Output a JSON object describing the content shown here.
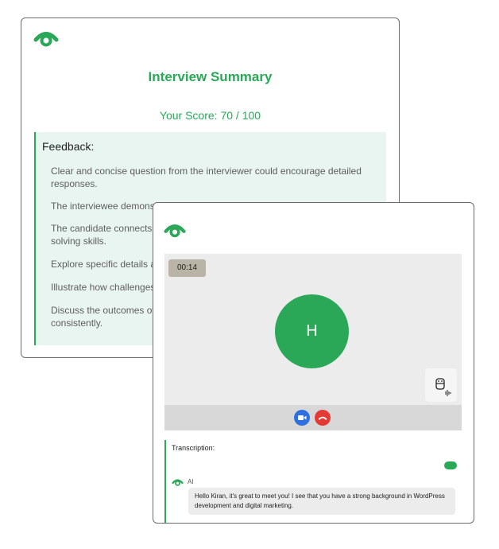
{
  "summary": {
    "logo_icon": "brand-logo-icon",
    "title": "Interview Summary",
    "score": "Your Score: 70 / 100",
    "feedback_title": "Feedback:",
    "feedback_items": [
      "Clear and concise question from the interviewer could encourage detailed responses.",
      "The interviewee demons",
      "The candidate connects",
      "solving skills.",
      "Explore specific details a",
      "Illustrate how challenges",
      "Discuss the outcomes of",
      "consistently."
    ]
  },
  "call": {
    "logo_icon": "brand-logo-icon",
    "timer": "00:14",
    "avatar_initial": "H",
    "side_icon": "robot-audio-icon",
    "controls": {
      "video_icon": "video-camera-icon",
      "end_icon": "end-call-icon"
    },
    "transcription_label": "Transcription:",
    "ai_name": "AI",
    "ai_message": "Hello Kiran, it's great to meet you! I see that you have a strong background in WordPress development and digital marketing."
  },
  "colors": {
    "brand_green": "#2aa858",
    "feedback_bg": "#e8f5f0",
    "video_blue": "#2f6fe0",
    "end_red": "#e53935"
  }
}
